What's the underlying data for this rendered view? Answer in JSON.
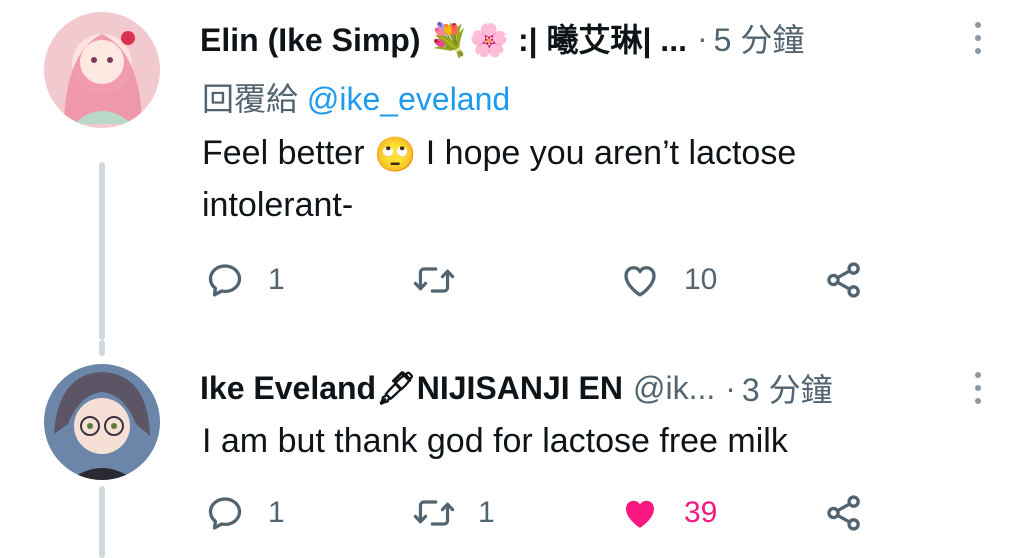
{
  "tweets": [
    {
      "display_name": "Elin (Ike Simp) 💐🌸 :| 曦艾琳| ...",
      "time": "5 分鐘",
      "reply_prefix": "回覆給",
      "reply_mention": "@ike_eveland",
      "text_before_emoji": "Feel better",
      "emoji": "🙄",
      "text_line1_after": "I hope you aren’t lactose",
      "text_line2": "intolerant-",
      "replies": "1",
      "retweets": "",
      "likes": "10",
      "liked": false,
      "avatar_bg": "#f2c9cf"
    },
    {
      "display_name": "Ike Eveland🖋NIJISANJI EN",
      "handle": "@ik...",
      "time": "3 分鐘",
      "text": "I am but thank god for lactose free milk",
      "replies": "1",
      "retweets": "1",
      "likes": "39",
      "liked": true,
      "avatar_bg": "#6b86a8"
    }
  ],
  "colors": {
    "text_primary": "#0f1419",
    "text_secondary": "#536471",
    "link": "#1d9bf0",
    "like_active": "#f91880",
    "thread_line": "#cfd9de"
  },
  "icons": [
    "reply-icon",
    "retweet-icon",
    "like-icon",
    "share-icon",
    "more-icon"
  ]
}
